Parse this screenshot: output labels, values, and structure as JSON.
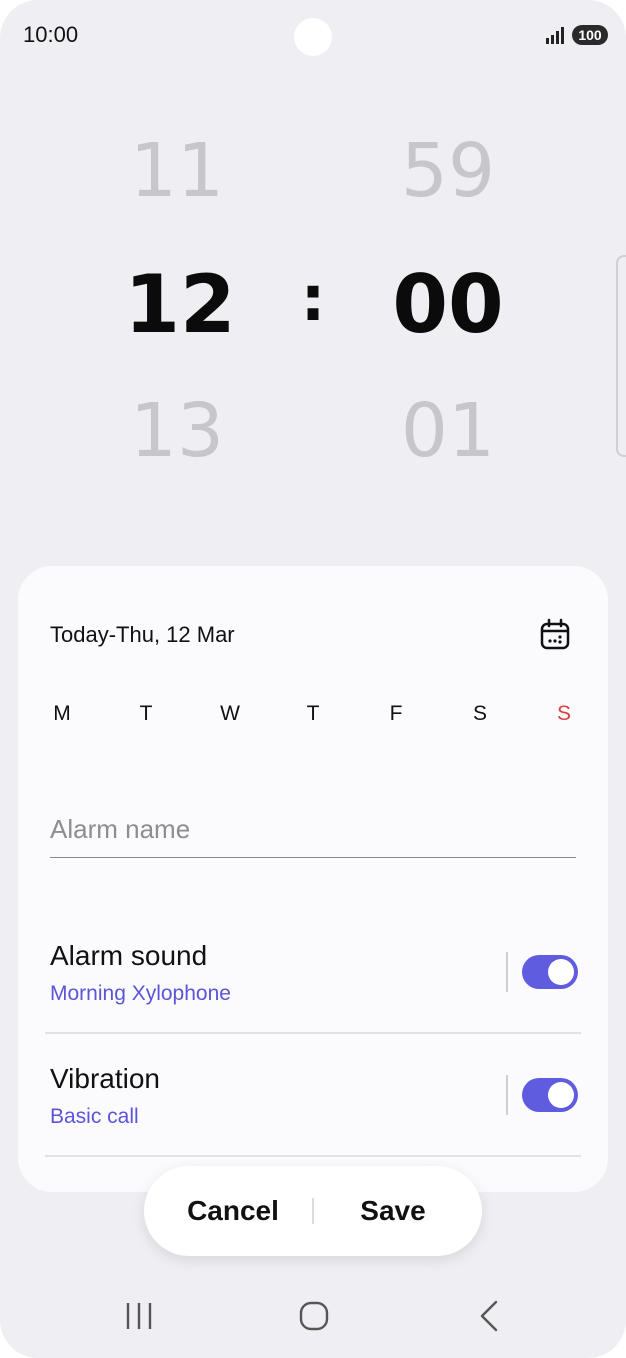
{
  "status_bar": {
    "time": "10:00",
    "battery": "100"
  },
  "time_picker": {
    "hour_prev": "11",
    "hour_selected": "12",
    "hour_next": "13",
    "separator": ":",
    "minute_prev": "59",
    "minute_selected": "00",
    "minute_next": "01"
  },
  "alarm_settings": {
    "date_text": "Today-Thu, 12 Mar",
    "days": [
      {
        "label": "M"
      },
      {
        "label": "T"
      },
      {
        "label": "W"
      },
      {
        "label": "T"
      },
      {
        "label": "F"
      },
      {
        "label": "S"
      },
      {
        "label": "S",
        "color": "#d8433d"
      }
    ],
    "alarm_name_placeholder": "Alarm name",
    "alarm_sound": {
      "title": "Alarm sound",
      "subtitle": "Morning Xylophone",
      "enabled": true
    },
    "vibration": {
      "title": "Vibration",
      "subtitle": "Basic call",
      "enabled": true
    }
  },
  "actions": {
    "cancel_label": "Cancel",
    "save_label": "Save"
  },
  "navigation_bar": {
    "icons": [
      "recent-apps-icon",
      "home-icon",
      "back-icon"
    ]
  },
  "colors": {
    "accent": "#5f5ce0",
    "subtitle": "#5b55d8",
    "sunday": "#d8433d",
    "background": "#efeff3",
    "card": "#fbfbfe"
  }
}
